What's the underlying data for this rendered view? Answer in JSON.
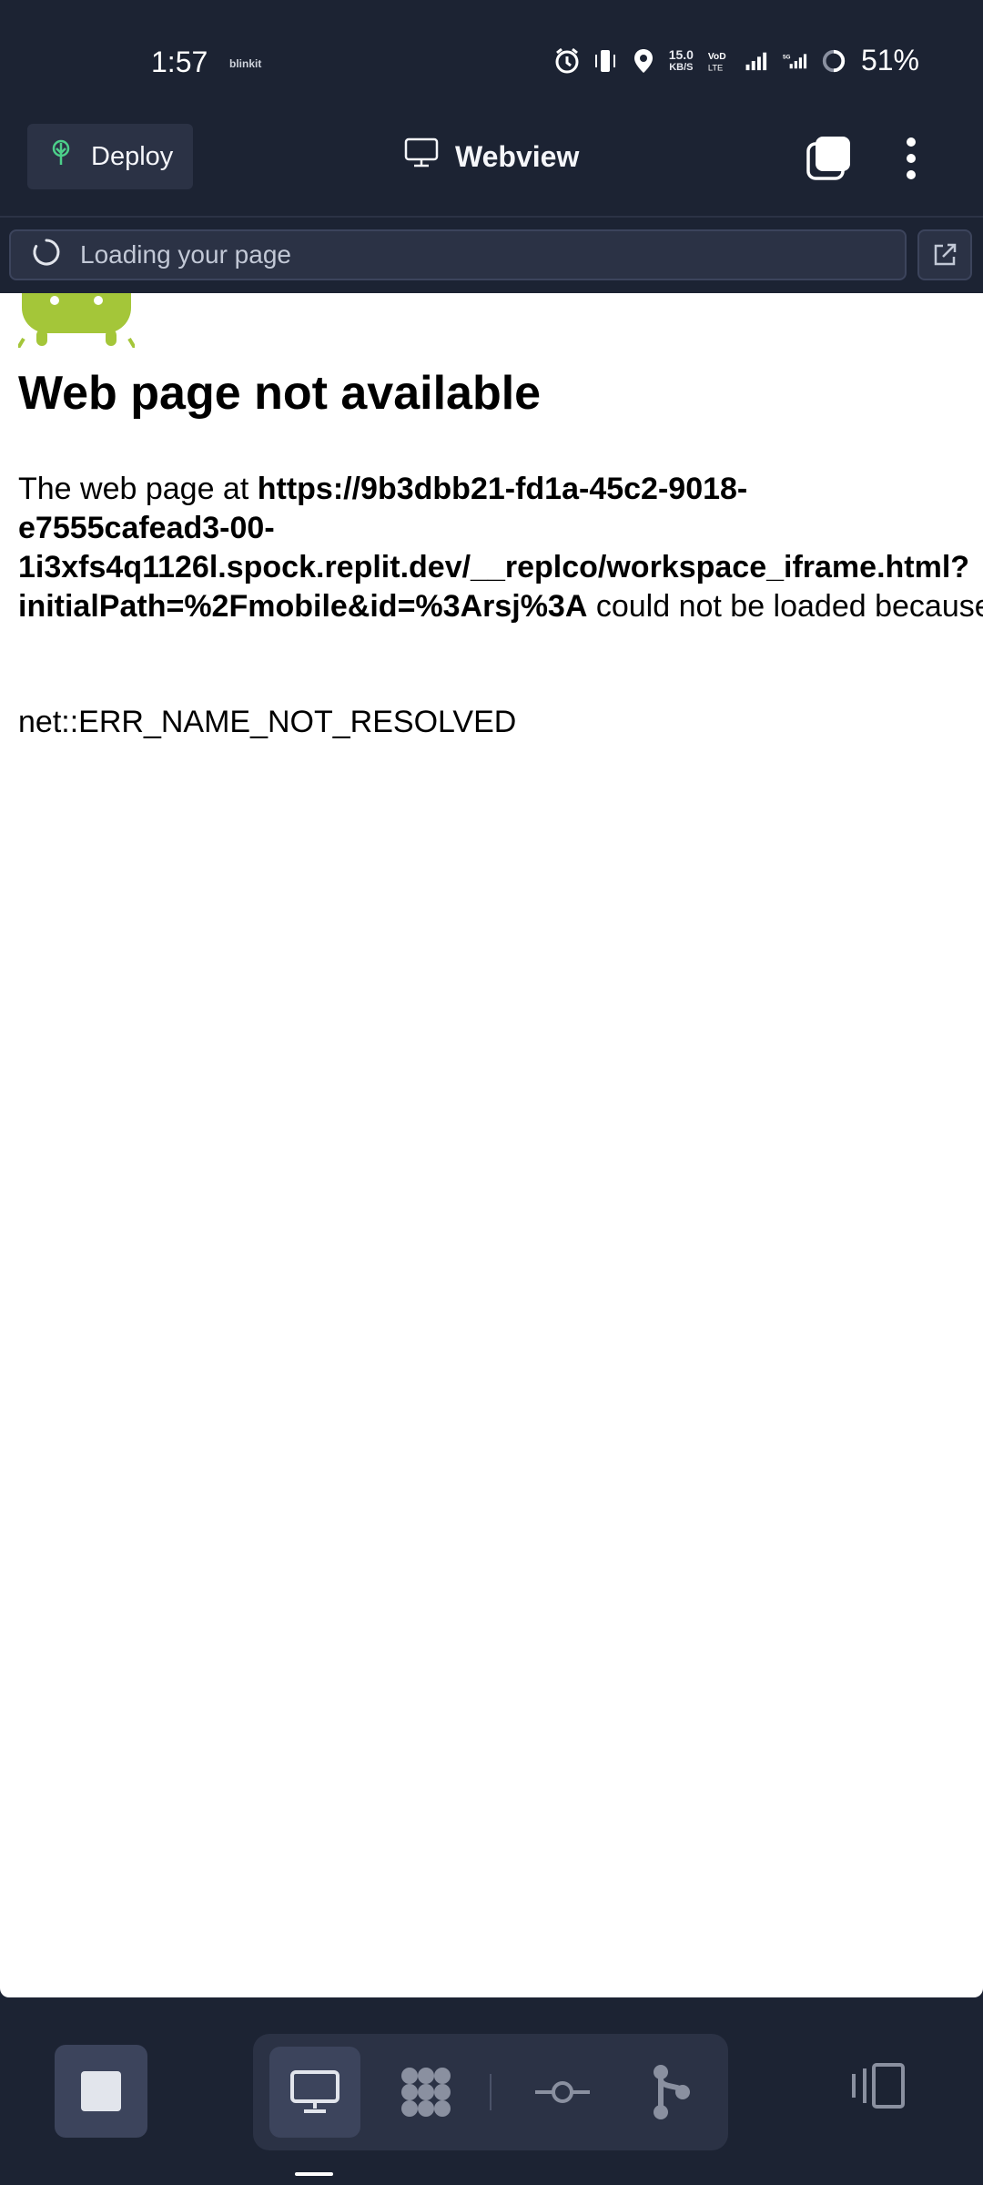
{
  "status_bar": {
    "time": "1:57",
    "notification_app": "blinkit",
    "net_speed_value": "15.0",
    "net_speed_unit": "KB/S",
    "battery": "51%"
  },
  "top_bar": {
    "deploy_label": "Deploy",
    "title": "Webview"
  },
  "url_bar": {
    "loading_text": "Loading your page"
  },
  "web_page": {
    "title": "Web page not available",
    "body_prefix": "The web page at ",
    "url": "https://9b3dbb21-fd1a-45c2-9018-e7555cafead3-00-1i3xfs4q1126l.spock.replit.dev/__replco/workspace_iframe.html?initialPath=%2Fmobile&id=%3Arsj%3A",
    "body_suffix": " could not be loaded because:",
    "error_code": "net::ERR_NAME_NOT_RESOLVED"
  },
  "colors": {
    "background": "#1c2333",
    "surface": "#2b3245",
    "android_green": "#a4c639"
  }
}
